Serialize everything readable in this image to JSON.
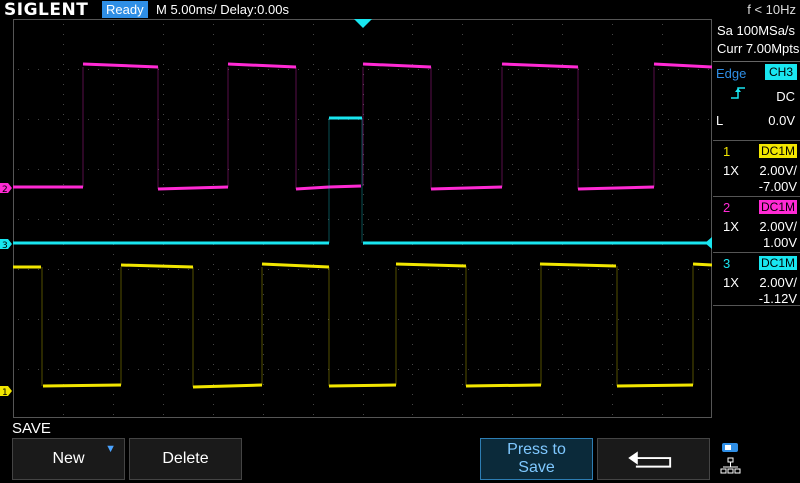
{
  "header": {
    "brand": "SIGLENT",
    "status": "Ready",
    "timebase": "M 5.00ms/ Delay:0.00s",
    "frequency": "f < 10Hz"
  },
  "acquisition": {
    "sample_rate": "Sa 100MSa/s",
    "memory": "Curr 7.00Mpts"
  },
  "trigger": {
    "type": "Edge",
    "source": "CH3",
    "coupling": "DC",
    "level_label": "L",
    "level": "0.0V"
  },
  "channels": [
    {
      "num": "1",
      "coupling": "DC1M",
      "probe": "1X",
      "scale": "2.00V/",
      "offset": "-7.00V",
      "color": "#f2e600"
    },
    {
      "num": "2",
      "coupling": "DC1M",
      "probe": "1X",
      "scale": "2.00V/",
      "offset": "1.00V",
      "color": "#ff2ad4"
    },
    {
      "num": "3",
      "coupling": "DC1M",
      "probe": "1X",
      "scale": "2.00V/",
      "offset": "-1.12V",
      "color": "#19e6f0"
    }
  ],
  "menu": {
    "title": "SAVE",
    "new_label": "New",
    "delete_label": "Delete",
    "press_to_save_line1": "Press to",
    "press_to_save_line2": "Save"
  },
  "colors": {
    "ch1": "#f2e600",
    "ch2": "#ff2ad4",
    "ch3": "#19e6f0",
    "accent": "#2f8fe6"
  }
}
